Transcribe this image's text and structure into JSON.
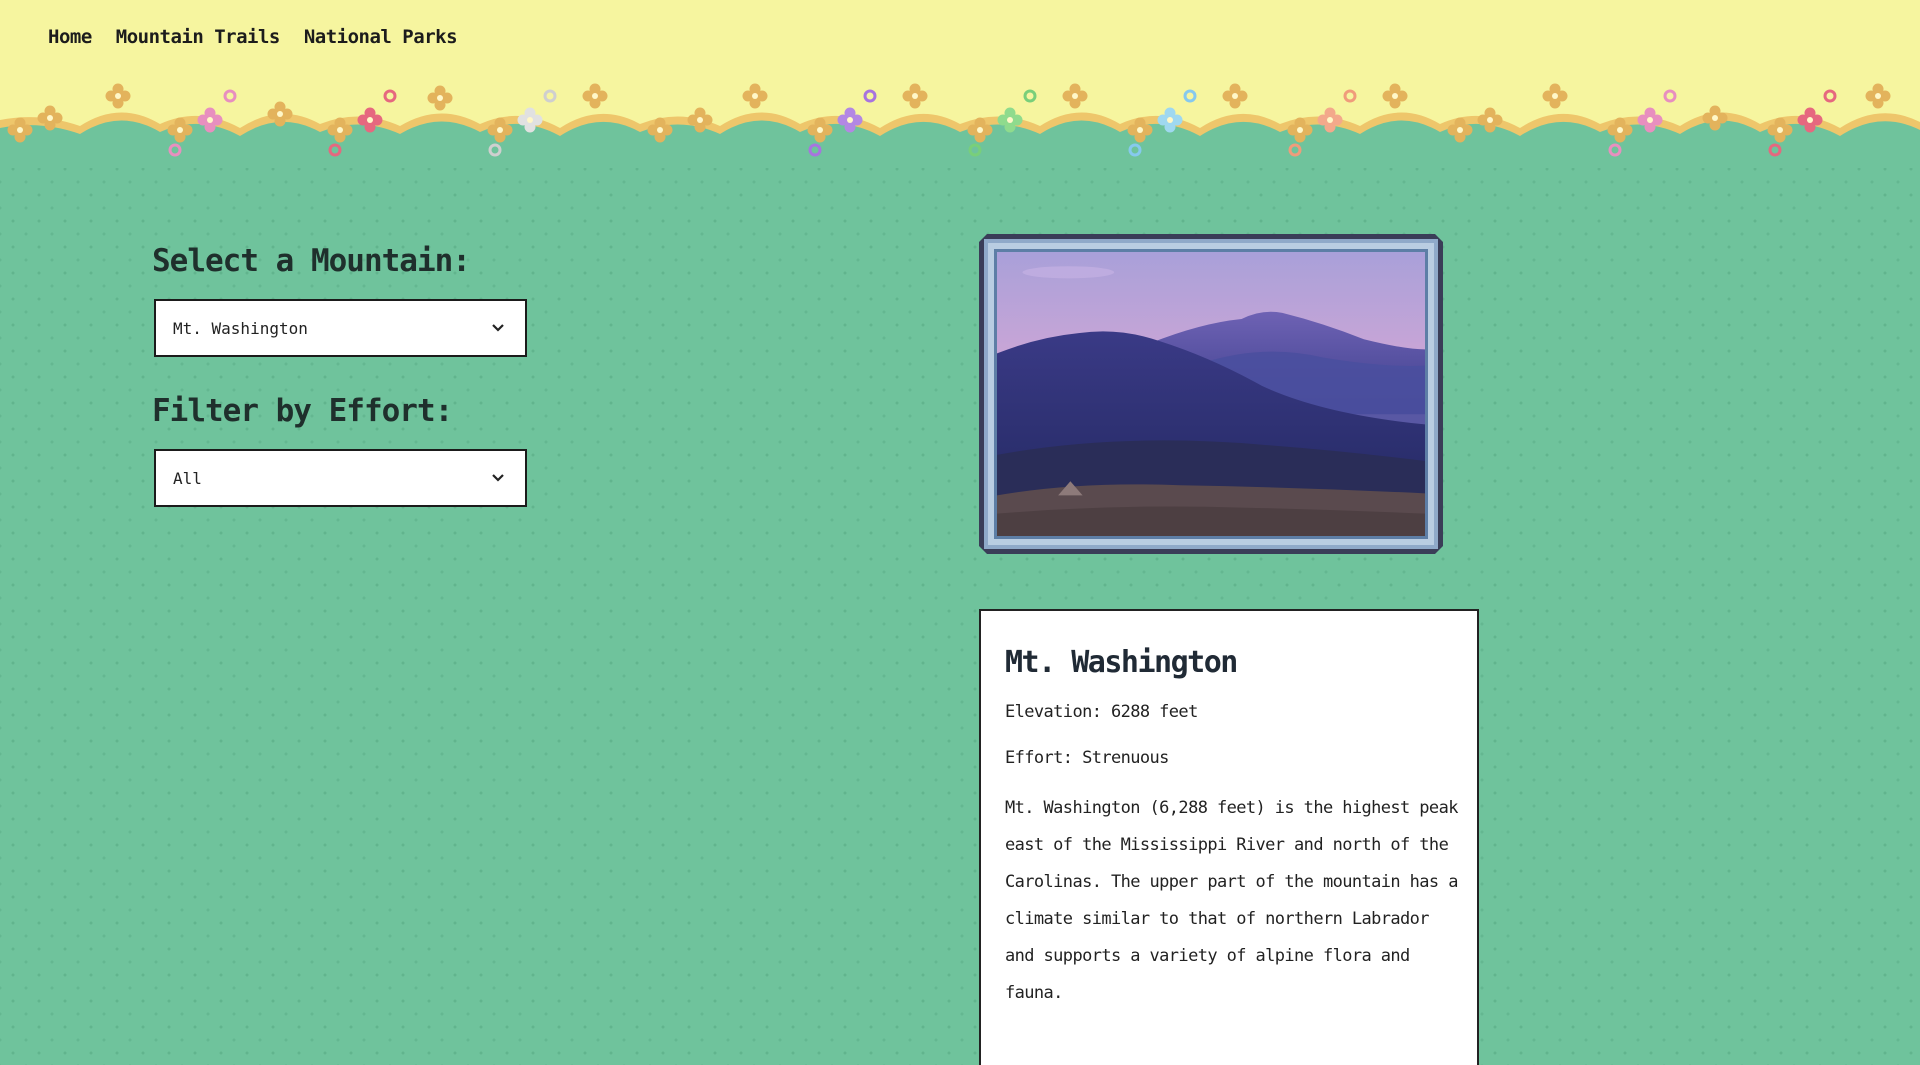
{
  "nav": {
    "items": [
      {
        "label": "Home"
      },
      {
        "label": "Mountain Trails"
      },
      {
        "label": "National Parks"
      }
    ]
  },
  "controls": {
    "mountain_label": "Select a Mountain:",
    "mountain_value": "Mt. Washington",
    "effort_label": "Filter by Effort:",
    "effort_value": "All"
  },
  "mountain": {
    "name": "Mt. Washington",
    "elevation": "Elevation: 6288 feet",
    "effort": "Effort: Strenuous",
    "description": "Mt. Washington (6,288 feet) is the highest peak east of the Mississippi River and north of the Carolinas. The upper part of the mountain has a climate similar to that of northern Labrador and supports a variety of alpine flora and fauna."
  },
  "icons": {
    "dropdown": "chevron-down-icon",
    "flower": "pixel-flower-icon"
  },
  "colors": {
    "header_bg": "#f6f59f",
    "grass_bg": "#6fc39c",
    "frame_dark": "#3a3d58",
    "frame_light": "#b9cde2"
  }
}
